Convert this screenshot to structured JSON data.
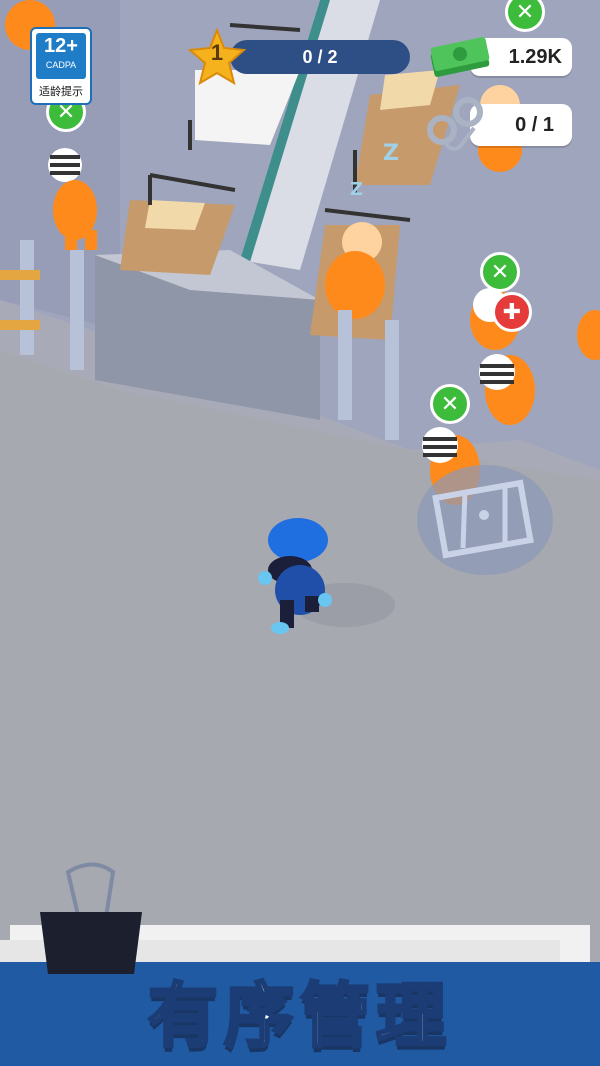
{
  "hud": {
    "level": "1",
    "progress_text": "0 / 2",
    "progress_fraction": 0,
    "money": "1.29K",
    "prisoners_text": "0 / 1"
  },
  "age_rating": {
    "rating": "12+",
    "org": "CADPA",
    "tip": "适龄提示"
  },
  "banner": {
    "title": "有序管理"
  },
  "icons": {
    "level": "star-icon",
    "money": "cash-stack-icon",
    "prisoners": "handcuffs-icon",
    "food": "fork-knife-icon",
    "medical": "red-cross-icon",
    "cell": "cell-door-icon",
    "clip": "binder-clip-icon"
  },
  "colors": {
    "prisoner": "#ff8a1c",
    "police": "#1f4fa8",
    "banner": "#1f5aa3",
    "food_pin": "#3dbb3a",
    "medical_pin": "#e53b3b"
  }
}
